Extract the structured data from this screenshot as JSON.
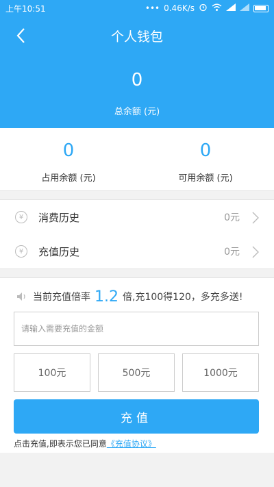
{
  "status_bar": {
    "time": "上午10:51",
    "net_speed": "0.46K/s"
  },
  "nav": {
    "title": "个人钱包"
  },
  "summary": {
    "total_value": "0",
    "total_label": "总余额 (元)"
  },
  "balances": [
    {
      "value": "0",
      "label": "占用余额 (元)"
    },
    {
      "value": "0",
      "label": "可用余额 (元)"
    }
  ],
  "history": [
    {
      "label": "消费历史",
      "amount": "0元"
    },
    {
      "label": "充值历史",
      "amount": "0元"
    }
  ],
  "recharge": {
    "promo_prefix": "当前充值倍率",
    "promo_rate": "1.2",
    "promo_suffix": "倍,充100得120，多充多送!",
    "input_placeholder": "请输入需要充值的金额",
    "presets": [
      "100元",
      "500元",
      "1000元"
    ],
    "submit_label": "充值",
    "agreement_text": "点击充值,即表示您已同意",
    "agreement_link": "《充值协议》"
  },
  "colors": {
    "accent": "#2ea8f5"
  }
}
